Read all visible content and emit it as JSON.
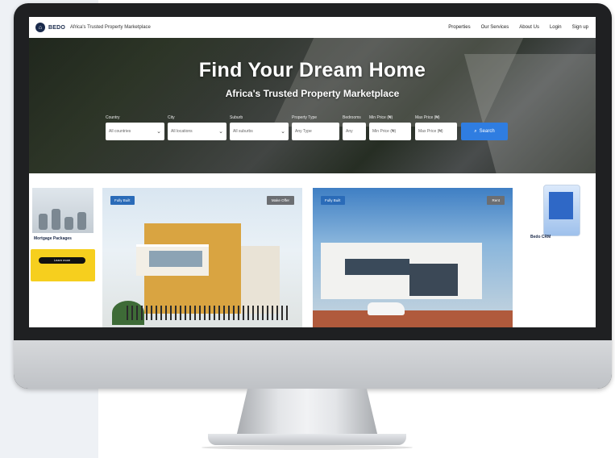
{
  "navbar": {
    "logo_text": "BEDO",
    "tagline": "Africa's Trusted Property Marketplace",
    "links": [
      "Properties",
      "Our Services",
      "About Us",
      "Login",
      "Sign up"
    ]
  },
  "hero": {
    "title": "Find Your Dream Home",
    "subtitle": "Africa's Trusted Property Marketplace"
  },
  "search": {
    "fields": [
      {
        "label": "Country",
        "value": "All countries"
      },
      {
        "label": "City",
        "value": "All locations"
      },
      {
        "label": "Suburb",
        "value": "All suburbs"
      },
      {
        "label": "Property Type",
        "value": "Any Type"
      },
      {
        "label": "Bedrooms",
        "value": "Any"
      },
      {
        "label": "Min Price (₦)",
        "value": "Min Price (₦)"
      },
      {
        "label": "Max Price (₦)",
        "value": "Max Price (₦)"
      }
    ],
    "button_label": "Search"
  },
  "ads": {
    "left_title": "Mortgage Packages",
    "left_button": "Learn more",
    "right_label": "Bedo CRM"
  },
  "listings": [
    {
      "tag": "Fully Built",
      "action": "Make Offer"
    },
    {
      "tag": "Fully Built",
      "action": "Rent"
    }
  ],
  "colors": {
    "accent": "#2f7de1",
    "tag": "#2a6bb8",
    "ad_yellow": "#f6cf1e",
    "brand_navy": "#1a2b4c"
  }
}
